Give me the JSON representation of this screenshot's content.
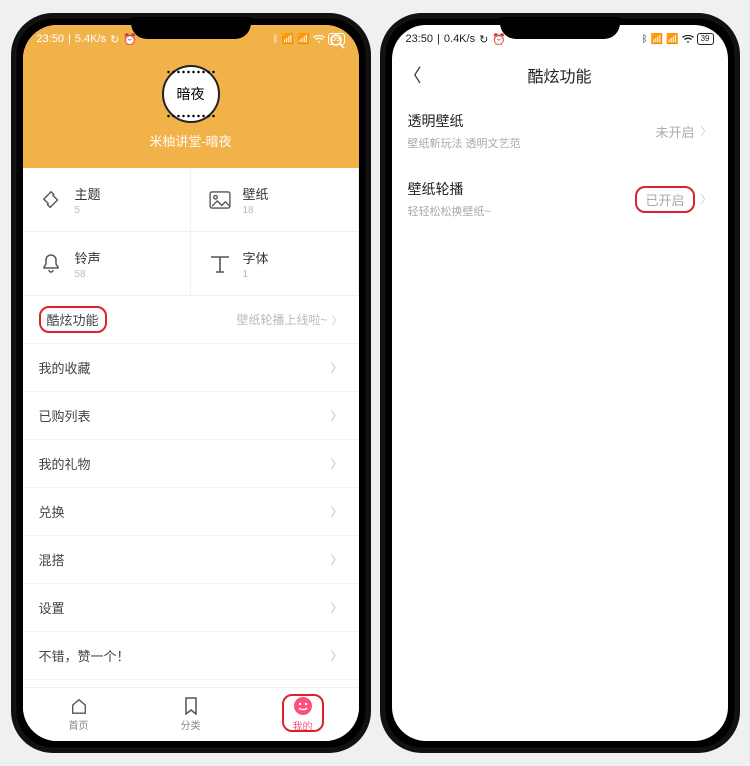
{
  "status": {
    "time": "23:50",
    "net1": "5.4K/s",
    "net2": "0.4K/s",
    "battery": "39"
  },
  "left": {
    "avatar_text": "暗夜",
    "username": "米柚讲堂-暗夜",
    "grid": [
      {
        "label": "主题",
        "count": "5"
      },
      {
        "label": "壁纸",
        "count": "18"
      },
      {
        "label": "铃声",
        "count": "58"
      },
      {
        "label": "字体",
        "count": "1"
      }
    ],
    "rows": [
      {
        "label": "酷炫功能",
        "detail": "壁纸轮播上线啦~",
        "highlight": true
      },
      {
        "label": "我的收藏",
        "detail": ""
      },
      {
        "label": "已购列表",
        "detail": ""
      },
      {
        "label": "我的礼物",
        "detail": ""
      },
      {
        "label": "兑换",
        "detail": ""
      },
      {
        "label": "混搭",
        "detail": ""
      },
      {
        "label": "设置",
        "detail": ""
      },
      {
        "label": "不错，赞一个！",
        "detail": ""
      }
    ],
    "nav": [
      {
        "label": "首页"
      },
      {
        "label": "分类"
      },
      {
        "label": "我的"
      }
    ]
  },
  "right": {
    "title": "酷炫功能",
    "items": [
      {
        "title": "透明壁纸",
        "sub": "壁纸新玩法 透明文艺范",
        "value": "未开启",
        "highlight": false
      },
      {
        "title": "壁纸轮播",
        "sub": "轻轻松松换壁纸~",
        "value": "已开启",
        "highlight": true
      }
    ]
  }
}
